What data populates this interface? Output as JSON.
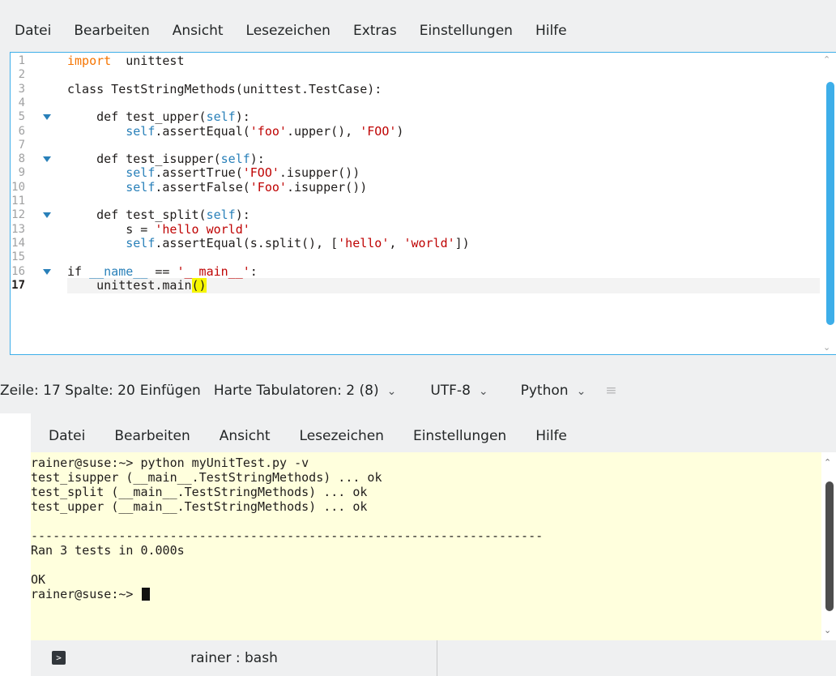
{
  "editor": {
    "menu": [
      "Datei",
      "Bearbeiten",
      "Ansicht",
      "Lesezeichen",
      "Extras",
      "Einstellungen",
      "Hilfe"
    ],
    "line_numbers": [
      "1",
      "2",
      "3",
      "4",
      "5",
      "6",
      "7",
      "8",
      "9",
      "10",
      "11",
      "12",
      "13",
      "14",
      "15",
      "16",
      "17"
    ],
    "current_line": "17",
    "code": [
      [
        [
          "kw",
          "import"
        ],
        [
          "",
          "  unittest"
        ]
      ],
      [],
      [
        [
          "",
          "class TestStringMethods(unittest.TestCase):"
        ]
      ],
      [],
      [
        [
          "",
          "    def test_upper("
        ],
        [
          "sf",
          "self"
        ],
        [
          "",
          "):"
        ]
      ],
      [
        [
          "",
          "        "
        ],
        [
          "sf",
          "self"
        ],
        [
          "",
          ".assertEqual("
        ],
        [
          "st",
          "'foo'"
        ],
        [
          "",
          ".upper(), "
        ],
        [
          "st",
          "'FOO'"
        ],
        [
          "",
          ")"
        ]
      ],
      [],
      [
        [
          "",
          "    def test_isupper("
        ],
        [
          "sf",
          "self"
        ],
        [
          "",
          "):"
        ]
      ],
      [
        [
          "",
          "        "
        ],
        [
          "sf",
          "self"
        ],
        [
          "",
          ".assertTrue("
        ],
        [
          "st",
          "'FOO'"
        ],
        [
          "",
          ".isupper())"
        ]
      ],
      [
        [
          "",
          "        "
        ],
        [
          "sf",
          "self"
        ],
        [
          "",
          ".assertFalse("
        ],
        [
          "st",
          "'Foo'"
        ],
        [
          "",
          ".isupper())"
        ]
      ],
      [],
      [
        [
          "",
          "    def test_split("
        ],
        [
          "sf",
          "self"
        ],
        [
          "",
          "):"
        ]
      ],
      [
        [
          "",
          "        s = "
        ],
        [
          "st",
          "'hello world'"
        ]
      ],
      [
        [
          "",
          "        "
        ],
        [
          "sf",
          "self"
        ],
        [
          "",
          ".assertEqual(s.split(), ["
        ],
        [
          "st",
          "'hello'"
        ],
        [
          "",
          ", "
        ],
        [
          "st",
          "'world'"
        ],
        [
          "",
          "])"
        ]
      ],
      [],
      [
        [
          "",
          "if "
        ],
        [
          "sf",
          "__name__"
        ],
        [
          "",
          " == "
        ],
        [
          "st",
          "'__main__'"
        ],
        [
          "",
          ":"
        ]
      ],
      [
        [
          "",
          "    unittest.main"
        ],
        [
          "hl",
          "()"
        ]
      ]
    ],
    "fold_markers": [
      "5",
      "8",
      "12",
      "16"
    ],
    "status": {
      "position": "Zeile: 17 Spalte: 20",
      "mode": "Einfügen",
      "indent": "Harte Tabulatoren: 2 (8)",
      "encoding": "UTF-8",
      "language": "Python"
    },
    "colors": {
      "keyword": "#f67400",
      "self": "#2980b9",
      "string": "#bf0303",
      "bracket_highlight": "#f6f600",
      "focus": "#3daee9"
    }
  },
  "terminal": {
    "menu": [
      "Datei",
      "Bearbeiten",
      "Ansicht",
      "Lesezeichen",
      "Einstellungen",
      "Hilfe"
    ],
    "lines": [
      "rainer@suse:~> python myUnitTest.py -v",
      "test_isupper (__main__.TestStringMethods) ... ok",
      "test_split (__main__.TestStringMethods) ... ok",
      "test_upper (__main__.TestStringMethods) ... ok",
      "",
      "----------------------------------------------------------------------",
      "Ran 3 tests in 0.000s",
      "",
      "OK",
      "rainer@suse:~> "
    ],
    "tab_label": "rainer : bash",
    "tab_icon": "terminal-icon",
    "colors": {
      "background": "#ffffdd"
    }
  }
}
